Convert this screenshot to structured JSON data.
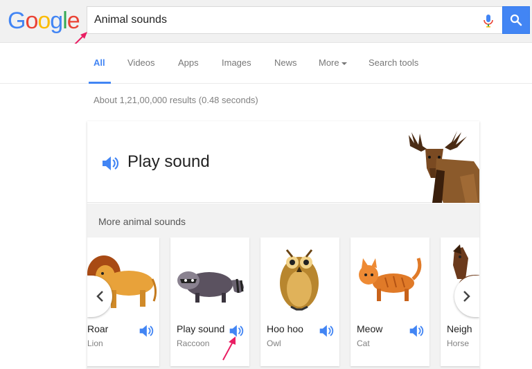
{
  "logo": {
    "text": "Google",
    "letters": [
      "G",
      "o",
      "o",
      "g",
      "l",
      "e"
    ],
    "colors": [
      "#4285f4",
      "#ea4335",
      "#fbbc05",
      "#4285f4",
      "#34a853",
      "#ea4335"
    ]
  },
  "search": {
    "query": "Animal sounds"
  },
  "tabs": [
    {
      "label": "All",
      "active": true
    },
    {
      "label": "Videos",
      "active": false
    },
    {
      "label": "Apps",
      "active": false
    },
    {
      "label": "Images",
      "active": false
    },
    {
      "label": "News",
      "active": false
    },
    {
      "label": "More",
      "active": false
    },
    {
      "label": "Search tools",
      "active": false
    }
  ],
  "result_stats": "About 1,21,00,000 results (0.48 seconds)",
  "card": {
    "play_label": "Play sound",
    "more_label": "More animal sounds",
    "animals": [
      {
        "sound": "Roar",
        "name": "Lion",
        "icon": "lion-icon"
      },
      {
        "sound": "Play sound",
        "name": "Raccoon",
        "icon": "raccoon-icon"
      },
      {
        "sound": "Hoo hoo",
        "name": "Owl",
        "icon": "owl-icon"
      },
      {
        "sound": "Meow",
        "name": "Cat",
        "icon": "cat-icon"
      },
      {
        "sound": "Neigh",
        "name": "Horse",
        "icon": "horse-icon"
      }
    ]
  },
  "colors": {
    "accent": "#4285f4",
    "annotation": "#e91e63"
  }
}
